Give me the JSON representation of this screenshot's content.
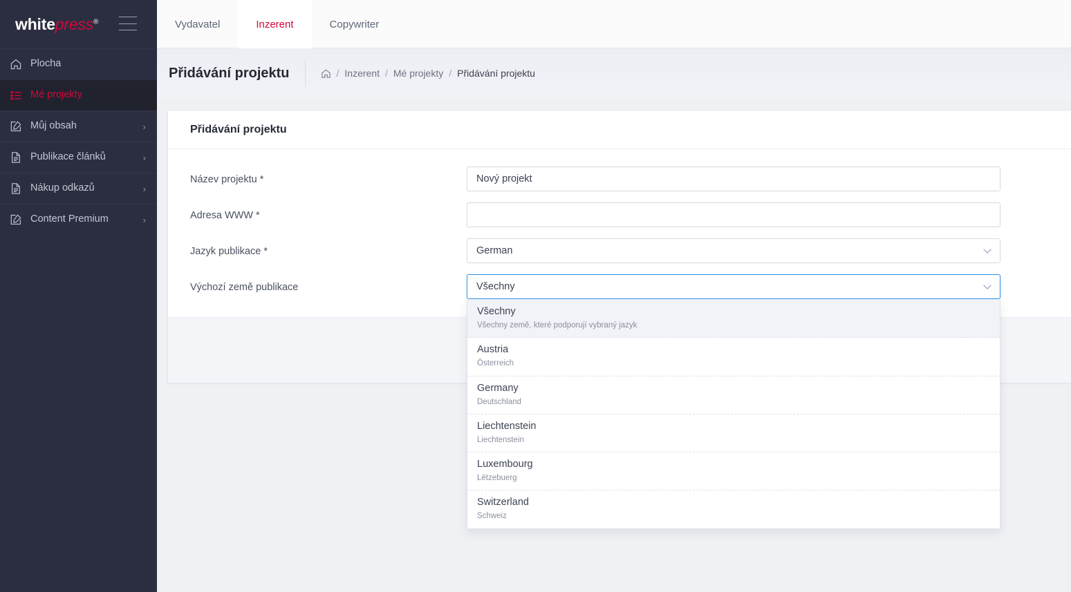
{
  "brand": {
    "logo_primary": "white",
    "logo_secondary": "press",
    "logo_mark": "®",
    "accent_color": "#d3073a",
    "sidebar_color": "#2b2e40",
    "focus_color": "#3191e3"
  },
  "sidebar": {
    "items": [
      {
        "label": "Plocha",
        "icon": "home-icon",
        "active": false,
        "has_chevron": false,
        "chevron": ""
      },
      {
        "label": "Mé projekty",
        "icon": "list-icon",
        "active": true,
        "has_chevron": false,
        "chevron": ""
      },
      {
        "label": "Můj obsah",
        "icon": "edit-icon",
        "active": false,
        "has_chevron": true,
        "chevron": "›"
      },
      {
        "label": "Publikace článků",
        "icon": "document-icon",
        "active": false,
        "has_chevron": true,
        "chevron": "›"
      },
      {
        "label": "Nákup odkazů",
        "icon": "document-icon",
        "active": false,
        "has_chevron": true,
        "chevron": "›"
      },
      {
        "label": "Content Premium",
        "icon": "edit-icon",
        "active": false,
        "has_chevron": true,
        "chevron": "›"
      }
    ]
  },
  "topbar": {
    "tabs": [
      {
        "label": "Vydavatel",
        "active": false
      },
      {
        "label": "Inzerent",
        "active": true
      },
      {
        "label": "Copywriter",
        "active": false
      }
    ]
  },
  "pageheader": {
    "title": "Přidávání projektu",
    "breadcrumb": [
      {
        "label": "Inzerent",
        "current": false
      },
      {
        "label": "Mé projekty",
        "current": false
      },
      {
        "label": "Přidávání projektu",
        "current": true
      }
    ],
    "separator": "/"
  },
  "card": {
    "title": "Přidávání projektu",
    "fields": [
      {
        "label": "Název projektu *",
        "type": "text",
        "value": "Nový projekt",
        "placeholder": "",
        "name": "project-name"
      },
      {
        "label": "Adresa WWW *",
        "type": "text",
        "value": "",
        "placeholder": "",
        "name": "project-url"
      },
      {
        "label": "Jazyk publikace *",
        "type": "select",
        "value": "German",
        "name": "publication-language",
        "has_help": true,
        "help_glyph": "?"
      },
      {
        "label": "Výchozí země publikace",
        "type": "select",
        "value": "Všechny",
        "name": "default-publication-country",
        "open": true
      }
    ],
    "country_options": [
      {
        "label": "Všechny",
        "sub": "Všechny země, které podporují vybraný jazyk",
        "selected": true
      },
      {
        "label": "Austria",
        "sub": "Österreich",
        "selected": false
      },
      {
        "label": "Germany",
        "sub": "Deutschland",
        "selected": false
      },
      {
        "label": "Liechtenstein",
        "sub": "Liechtenstein",
        "selected": false
      },
      {
        "label": "Luxembourg",
        "sub": "Lëtzebuerg",
        "selected": false
      },
      {
        "label": "Switzerland",
        "sub": "Schweiz",
        "selected": false
      }
    ]
  }
}
